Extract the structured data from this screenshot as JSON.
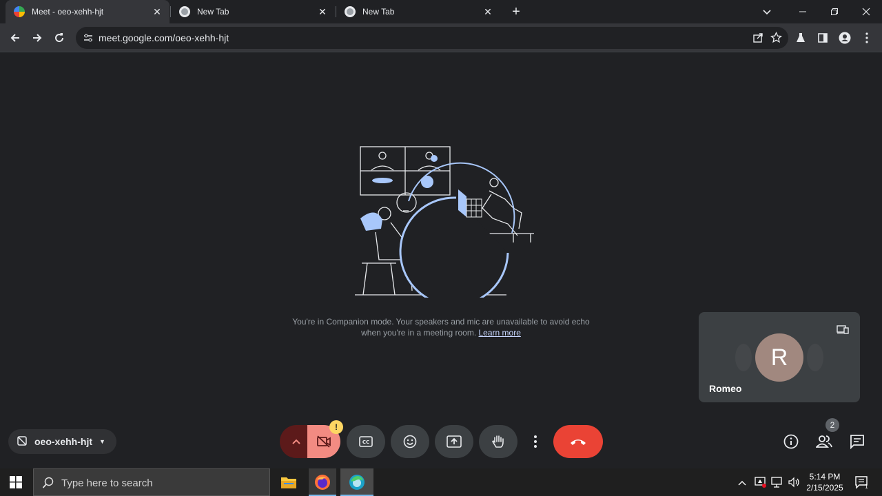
{
  "browser": {
    "tabs": [
      {
        "title": "Meet - oeo-xehh-hjt",
        "active": true
      },
      {
        "title": "New Tab",
        "active": false
      },
      {
        "title": "New Tab",
        "active": false
      }
    ],
    "url": "meet.google.com/oeo-xehh-hjt"
  },
  "meet": {
    "companion_text": "You're in Companion mode. Your speakers and mic are unavailable to avoid echo when you're in a meeting room.",
    "learn_more": "Learn more",
    "participant": {
      "initial": "R",
      "name": "Romeo"
    },
    "meeting_code": "oeo-xehh-hjt",
    "people_count": "2",
    "warning_badge": "!"
  },
  "taskbar": {
    "search_placeholder": "Type here to search",
    "time": "5:14 PM",
    "date": "2/15/2025"
  },
  "colors": {
    "accent_red": "#ea4335",
    "camera_off": "#f28b82",
    "badge_yellow": "#fdd663"
  }
}
